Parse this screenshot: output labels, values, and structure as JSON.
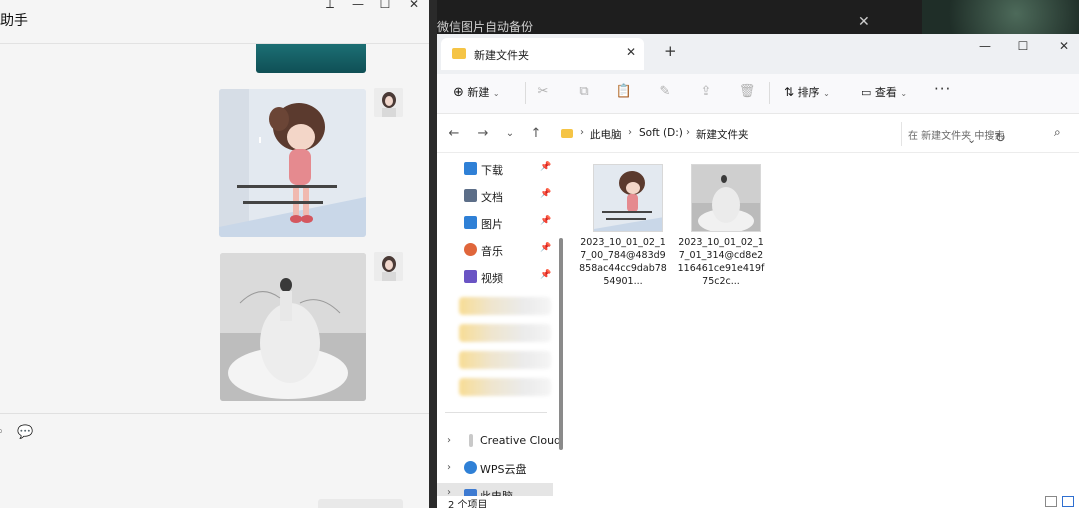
{
  "chat": {
    "title": "助手",
    "window_controls": [
      "pin",
      "minimize",
      "maximize",
      "close"
    ]
  },
  "background_window": {
    "title": "微信图片自动备份"
  },
  "explorer": {
    "tab_label": "新建文件夹",
    "toolbar": {
      "new_label": "新建",
      "sort_label": "排序",
      "view_label": "查看",
      "more_label": "···"
    },
    "breadcrumb": [
      "此电脑",
      "Soft (D:)",
      "新建文件夹"
    ],
    "search_placeholder": "在 新建文件夹 中搜索",
    "nav_items": [
      {
        "label": "下载",
        "icon": "download-icon",
        "color": "#2f80d6"
      },
      {
        "label": "文档",
        "icon": "document-icon",
        "color": "#5c6e88"
      },
      {
        "label": "图片",
        "icon": "pictures-icon",
        "color": "#2f80d6"
      },
      {
        "label": "音乐",
        "icon": "music-icon",
        "color": "#e0663b"
      },
      {
        "label": "视频",
        "icon": "video-icon",
        "color": "#6a54c4"
      }
    ],
    "tree_items": [
      {
        "label": "Creative Cloud"
      },
      {
        "label": "WPS云盘"
      },
      {
        "label": "此电脑"
      }
    ],
    "files": [
      {
        "name": "2023_10_01_02_17_00_784@483d9858ac44cc9dab7854901..."
      },
      {
        "name": "2023_10_01_02_17_01_314@cd8e2116461ce91e419f75c2c..."
      }
    ],
    "status_text": "2 个项目"
  },
  "colors": {
    "folder": "#f5c445",
    "explorer_bg": "#ffffff",
    "titlebar_bg": "#eef0f3",
    "chat_bg": "#f5f5f5"
  }
}
